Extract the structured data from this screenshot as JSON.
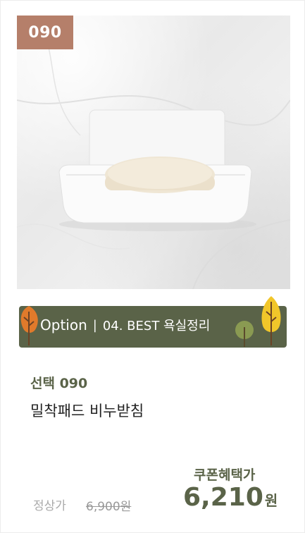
{
  "badge": {
    "code": "090"
  },
  "banner": {
    "option_label": "Option",
    "separator": "|",
    "category": "04. BEST 욕실정리"
  },
  "product": {
    "option_name": "선택 090",
    "name": "밀착패드 비누받침"
  },
  "price": {
    "regular_label": "정상가",
    "regular_value": "6,900",
    "regular_unit": "원",
    "coupon_label": "쿠폰혜택가",
    "coupon_value": "6,210",
    "coupon_unit": "원"
  },
  "colors": {
    "badge_bg": "#b57f6a",
    "banner_bg": "#5a6348",
    "accent_text": "#5a6348"
  }
}
